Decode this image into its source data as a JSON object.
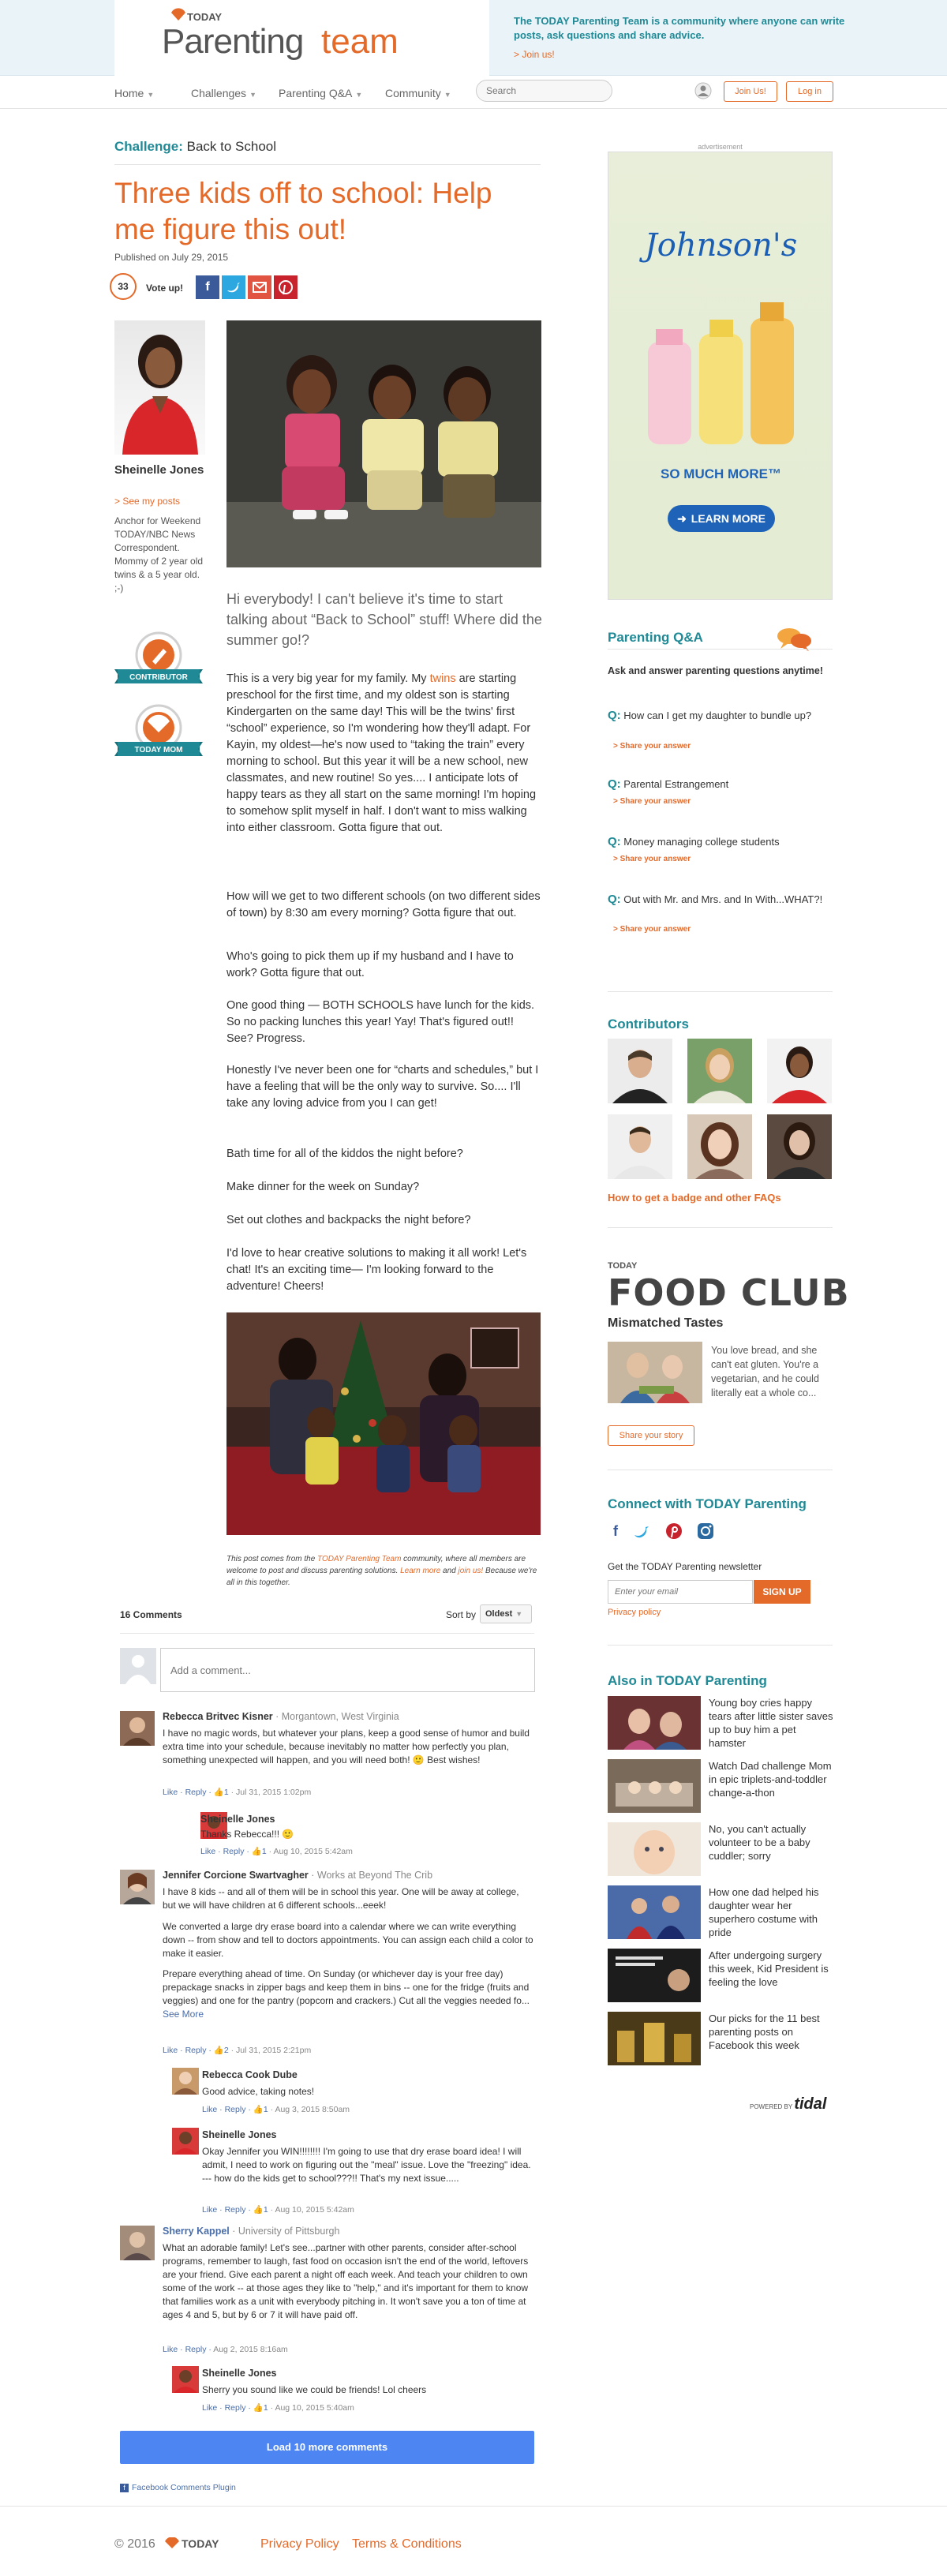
{
  "header": {
    "logo_today": "TODAY",
    "logo_parenting": "Parenting",
    "logo_team": "team",
    "tagline": "The TODAY Parenting Team is a community where anyone can write posts, ask questions and share advice.",
    "join_link": "> Join us!"
  },
  "nav": {
    "items": [
      "Home",
      "Challenges",
      "Parenting Q&A",
      "Community"
    ],
    "search_placeholder": "Search",
    "join_button": "Join Us!",
    "login_button": "Log in"
  },
  "article": {
    "crumb_label": "Challenge:",
    "crumb_value": "Back to School",
    "title": "Three kids off to school: Help me figure this out!",
    "published": "Published on July 29, 2015",
    "votes": "33",
    "vote_label": "Vote up!",
    "lead": "Hi everybody! I can't believe it's time to start talking about “Back to School” stuff! Where did the summer go!?",
    "para1_pre": "This is a very big year for my family. My ",
    "para1_link": "twins",
    "para1_post": " are starting preschool for the first time, and my oldest son is starting Kindergarten on the same day! This will be the twins' first “school” experience, so I'm wondering how they'll adapt. For Kayin, my oldest—he's now used to “taking the train” every morning to school. But this year it will be a new school, new classmates, and new routine! So yes.... I anticipate lots of happy tears as they all start on the same morning! I'm hoping to somehow split myself in half. I don't want to miss walking into either classroom. Gotta figure that out.",
    "para2": "How will we get to two different schools (on two different sides of town) by 8:30 am every morning? Gotta figure that out.",
    "para3": "Who's going to pick them up if my husband and I have to work? Gotta figure that out.",
    "para4": "One good thing — BOTH SCHOOLS have lunch for the kids. So no packing lunches this year! Yay! That's figured out!! See? Progress.",
    "para5": "Honestly I've never been one for “charts and schedules,” but I have a feeling that will be the only way to survive. So.... I'll take any loving advice from you I can get!",
    "para6": "Bath time for all of the kiddos the night before?",
    "para7": "Make dinner for the week on Sunday?",
    "para8": "Set out clothes and backpacks the night before?",
    "para9": "I'd love to hear creative solutions to making it all work! Let's chat! It's an exciting time— I'm looking forward to the adventure! Cheers!",
    "note_pre": "This post comes from the ",
    "note_link1": "TODAY Parenting Team",
    "note_mid": " community, where all members are welcome to post and discuss parenting solutions. ",
    "note_link2": "Learn more",
    "note_and": " and ",
    "note_link3": "join us!",
    "note_post": " Because we're all in this together."
  },
  "author": {
    "name": "Sheinelle Jones",
    "see_posts": "> See my posts",
    "bio": "Anchor for Weekend TODAY/NBC News Correspondent. Mommy of 2 year old twins & a 5 year old. ;-)",
    "badge1": "CONTRIBUTOR",
    "badge2": "TODAY MOM"
  },
  "comments": {
    "count": "16 Comments",
    "sort_label": "Sort by",
    "sort_value": "Oldest",
    "placeholder": "Add a comment...",
    "c1": {
      "name": "Rebecca Britvec Kisner",
      "aff": " · Morgantown, West Virginia",
      "text": "I have no magic words, but whatever your plans, keep a good sense of humor and build extra time into your schedule, because inevitably no matter how perfectly you plan, something unexpected will happen, and you will need both! 🙂 Best wishes!",
      "meta_actions": "Like · Reply · ",
      "likes": "1",
      "meta_time": " · Jul 31, 2015 1:02pm"
    },
    "r1": {
      "name": "Sheinelle Jones",
      "text": "Thanks Rebecca!!! 🙂",
      "meta_actions": "Like · Reply · ",
      "likes": "1",
      "meta_time": " · Aug 10, 2015 5:42am"
    },
    "c2": {
      "name": "Jennifer Corcione Swartvagher",
      "aff": " · Works at Beyond The Crib",
      "text1": "I have 8 kids -- and all of them will be in school this year. One will be away at college, but we will have children at 6 different schools...eeek!",
      "text2": "We converted a large dry erase board into a calendar where we can write everything down -- from show and tell to doctors appointments. You can assign each child a color to make it easier.",
      "text3": "Prepare everything ahead of time. On Sunday (or whichever day is your free day) prepackage snacks in zipper bags and keep them in bins -- one for the fridge (fruits and veggies) and one for the pantry (popcorn and crackers.) Cut all the veggies needed fo... ",
      "see_more": "See More",
      "meta_actions": "Like · Reply · ",
      "likes": "2",
      "meta_time": " · Jul 31, 2015 2:21pm"
    },
    "r2": {
      "name": "Rebecca Cook Dube",
      "text": "Good advice, taking notes!",
      "meta_actions": "Like · Reply · ",
      "likes": "1",
      "meta_time": " · Aug 3, 2015 8:50am"
    },
    "r3": {
      "name": "Sheinelle Jones",
      "text": "Okay Jennifer you WIN!!!!!!!! I'm going to use that dry erase board idea! I will admit, I need to work on figuring out the \"meal\" issue. Love the \"freezing\" idea. --- how do the kids get to school???!! That's my next issue.....",
      "meta_actions": "Like · Reply · ",
      "likes": "1",
      "meta_time": " · Aug 10, 2015 5:42am"
    },
    "c3": {
      "name": "Sherry Kappel",
      "aff": " · University of Pittsburgh",
      "text": "What an adorable family! Let's see...partner with other parents, consider after-school programs, remember to laugh, fast food on occasion isn't the end of the world, leftovers are your friend. Give each parent a night off each week. And teach your children to own some of the work -- at those ages they like to \"help,\" and it's important for them to know that families work as a unit with everybody pitching in. It won't save you a ton of time at ages 4 and 5, but by 6 or 7 it will have paid off.",
      "meta_actions": "Like · Reply · ",
      "meta_time": "Aug 2, 2015 8:16am"
    },
    "r4": {
      "name": "Sheinelle Jones",
      "text": "Sherry you sound like we could be friends! Lol cheers",
      "meta_actions": "Like · Reply · ",
      "likes": "1",
      "meta_time": " · Aug 10, 2015 5:40am"
    },
    "load_more": "Load 10 more comments",
    "fb_plugin": "Facebook Comments Plugin"
  },
  "sidebar": {
    "ad_label": "advertisement",
    "ad_brand": "Johnson's",
    "ad_tagline": "SO MUCH MORE™",
    "ad_button": "LEARN MORE",
    "qa_title": "Parenting Q&A",
    "qa_sub": "Ask and answer parenting questions anytime!",
    "qa_q_mark": "Q:",
    "qa_items": [
      {
        "q": "How can I get my daughter to bundle up?",
        "share": "> Share your answer"
      },
      {
        "q": "Parental Estrangement",
        "share": "> Share your answer"
      },
      {
        "q": "Money managing college students",
        "share": "> Share your answer"
      },
      {
        "q": "Out with Mr. and Mrs. and In With...WHAT?!",
        "share": "> Share your answer"
      }
    ],
    "contributors_title": "Contributors",
    "badge_faq": "How to get a badge and other FAQs",
    "food_today": "TODAY",
    "food_logo": "FOOD CLUB",
    "food_title": "Mismatched Tastes",
    "food_text": "You love bread, and she can't eat gluten. You're a vegetarian, and he could literally eat a whole co...",
    "share_story": "Share your story",
    "connect_title": "Connect with TODAY Parenting",
    "newsletter_label": "Get the TODAY Parenting newsletter",
    "newsletter_placeholder": "Enter your email",
    "signup": "SIGN UP",
    "privacy": "Privacy policy",
    "also_title": "Also in TODAY Parenting",
    "also": [
      "Young boy cries happy tears after little sister saves up to buy him a pet hamster",
      "Watch Dad challenge Mom in epic triplets-and-toddler change-a-thon",
      "No, you can't actually volunteer to be a baby cuddler; sorry",
      "How one dad helped his daughter wear her superhero costume with pride",
      "After undergoing surgery this week, Kid President is feeling the love",
      "Our picks for the 11 best parenting posts on Facebook this week"
    ],
    "tidal_label": "POWERED BY",
    "tidal_brand": "tidal"
  },
  "footer": {
    "copyright": "© 2016",
    "today": "TODAY",
    "privacy": "Privacy Policy",
    "terms": "Terms & Conditions"
  },
  "colors": {
    "accent": "#e46a2a",
    "teal": "#1f8a96",
    "fb_blue": "#4d85f2"
  }
}
